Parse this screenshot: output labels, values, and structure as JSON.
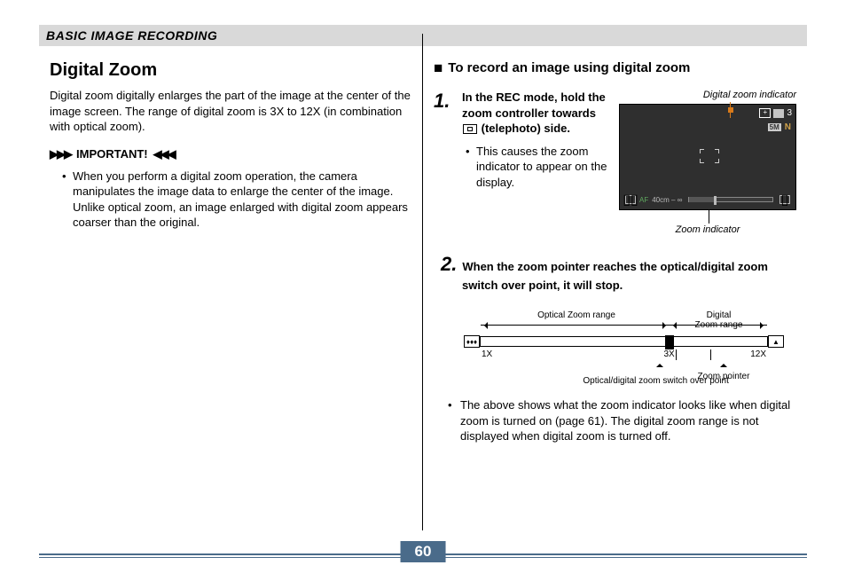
{
  "header": "BASIC IMAGE RECORDING",
  "page_number": "60",
  "left": {
    "title": "Digital Zoom",
    "intro": "Digital zoom digitally enlarges the part of the image at the center of the image screen. The range of digital zoom is 3X to 12X (in combination with optical zoom).",
    "important_label": "IMPORTANT!",
    "important_bullet": "When you perform a digital zoom operation, the camera manipulates the image data to enlarge the center of the image. Unlike optical zoom, an image enlarged with digital zoom appears coarser than the original."
  },
  "right": {
    "subheading": "To record an image using digital zoom",
    "step1": {
      "num": "1.",
      "lead_a": "In the REC mode, hold the zoom controller towards",
      "lead_b": "(telephoto) side.",
      "bullet": "This causes the zoom indicator to appear on the display."
    },
    "screen": {
      "caption_top": "Digital zoom indicator",
      "caption_bottom": "Zoom indicator",
      "shots_remaining": "3",
      "size_badge": "5M",
      "quality": "N",
      "af_label": "AF",
      "distance": "40cm – ∞"
    },
    "step2": {
      "num": "2.",
      "lead": "When the zoom pointer reaches the optical/digital zoom switch over point, it will stop."
    },
    "diagram": {
      "optical_label": "Optical Zoom range",
      "digital_label_line1": "Digital",
      "digital_label_line2": "Zoom range",
      "x1": "1X",
      "x3": "3X",
      "x12": "12X",
      "zoom_pointer": "Zoom pointer",
      "switch_point": "Optical/digital zoom switch over point"
    },
    "note": "The above shows what the zoom indicator looks like when digital zoom is turned on (page 61). The digital zoom range is not displayed when digital zoom is turned off."
  }
}
